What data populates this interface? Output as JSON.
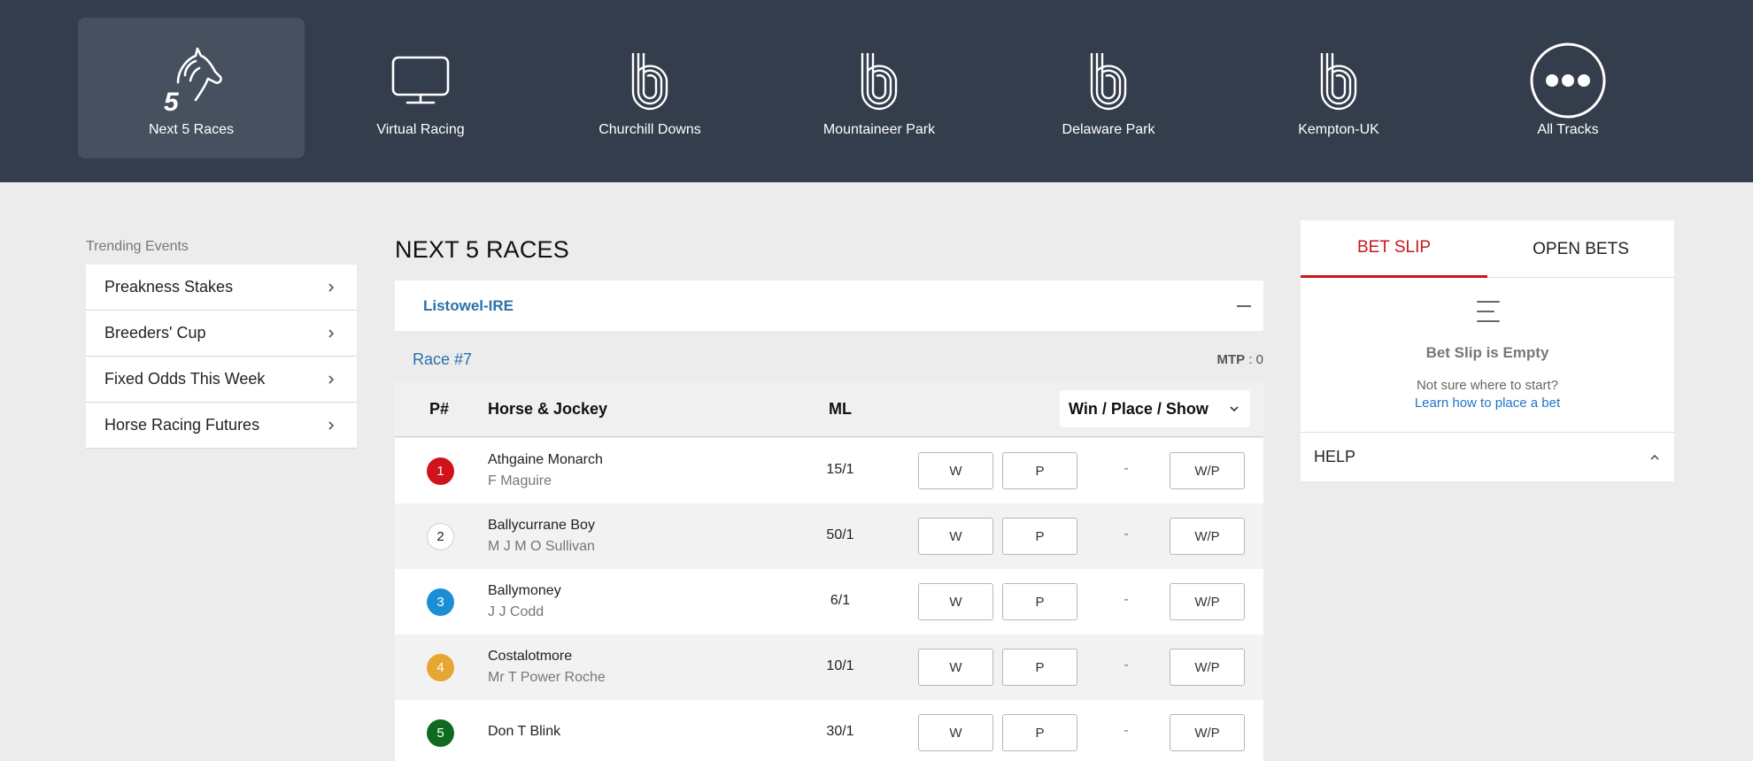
{
  "nav": {
    "tiles": [
      {
        "label": "Next 5 Races",
        "icon": "horse-head-5-icon",
        "active": true
      },
      {
        "label": "Virtual Racing",
        "icon": "monitor-icon"
      },
      {
        "label": "Churchill Downs",
        "icon": "race-track-icon"
      },
      {
        "label": "Mountaineer Park",
        "icon": "race-track-icon"
      },
      {
        "label": "Delaware Park",
        "icon": "race-track-icon"
      },
      {
        "label": "Kempton-UK",
        "icon": "race-track-icon"
      },
      {
        "label": "All Tracks",
        "icon": "more-dots-icon"
      }
    ]
  },
  "sidebar": {
    "title": "Trending Events",
    "items": [
      {
        "label": "Preakness Stakes"
      },
      {
        "label": "Breeders' Cup"
      },
      {
        "label": "Fixed Odds This Week"
      },
      {
        "label": "Horse Racing Futures"
      }
    ]
  },
  "main": {
    "title": "NEXT 5 RACES",
    "track": "Listowel-IRE",
    "race": "Race #7",
    "mtp_label": "MTP",
    "mtp_value": ": 0",
    "columns": {
      "pnum": "P#",
      "horse": "Horse & Jockey",
      "ml": "ML",
      "bet_type": "Win / Place / Show"
    },
    "buttons": {
      "w": "W",
      "p": "P",
      "dash": "-",
      "wp": "W/P"
    },
    "runners": [
      {
        "num": "1",
        "horse": "Athgaine Monarch",
        "jockey": "F Maguire",
        "ml": "15/1",
        "color": "#d0121b",
        "text_color": "#ffffff"
      },
      {
        "num": "2",
        "horse": "Ballycurrane Boy",
        "jockey": "M J M O Sullivan",
        "ml": "50/1",
        "color": "#ffffff",
        "text_color": "#222222"
      },
      {
        "num": "3",
        "horse": "Ballymoney",
        "jockey": "J J Codd",
        "ml": "6/1",
        "color": "#1b8fd6",
        "text_color": "#ffffff"
      },
      {
        "num": "4",
        "horse": "Costalotmore",
        "jockey": "Mr T Power Roche",
        "ml": "10/1",
        "color": "#e5a632",
        "text_color": "#ffffff"
      },
      {
        "num": "5",
        "horse": "Don T Blink",
        "jockey": "",
        "ml": "30/1",
        "color": "#0e6b1e",
        "text_color": "#ffffff"
      }
    ]
  },
  "betslip": {
    "tab_slip": "BET SLIP",
    "tab_open": "OPEN BETS",
    "empty_title": "Bet Slip is Empty",
    "note": "Not sure where to start?",
    "link": "Learn how to place a bet",
    "help": "HELP"
  },
  "colors": {
    "nav_bg": "#343d4b",
    "accent_red": "#c8161d",
    "link_blue": "#2c6fab"
  }
}
